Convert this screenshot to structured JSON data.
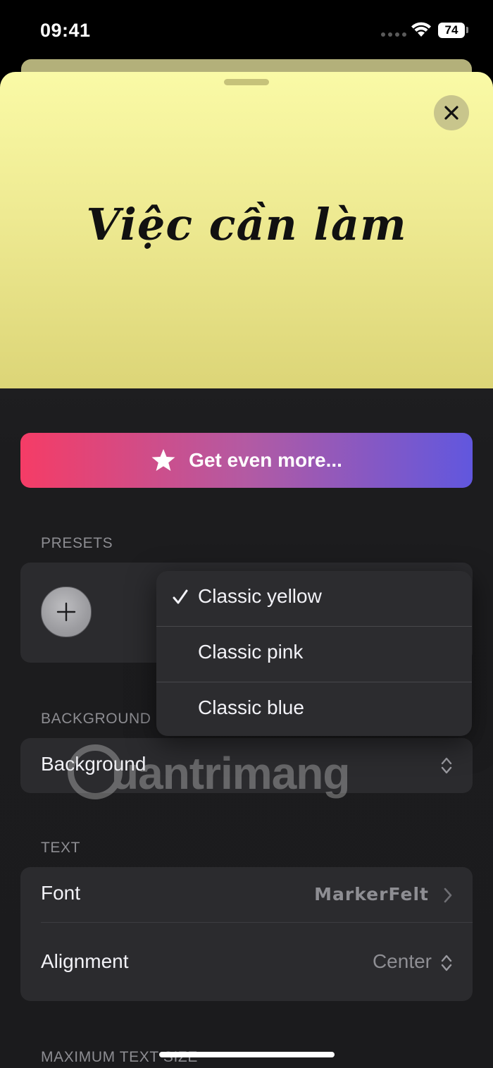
{
  "status_bar": {
    "time": "09:41",
    "battery": "74"
  },
  "preview": {
    "title": "Việc cần làm",
    "background_color": "#eeea92"
  },
  "promo": {
    "label": "Get even more..."
  },
  "presets": {
    "section_label": "PRESETS",
    "menu": [
      {
        "label": "Classic yellow",
        "selected": true
      },
      {
        "label": "Classic pink",
        "selected": false
      },
      {
        "label": "Classic blue",
        "selected": false
      }
    ]
  },
  "background": {
    "section_label": "BACKGROUND",
    "row_label": "Background"
  },
  "text": {
    "section_label": "TEXT",
    "font_label": "Font",
    "font_value": "MarkerFelt",
    "alignment_label": "Alignment",
    "alignment_value": "Center"
  },
  "max_text_size": {
    "section_label": "MAXIMUM TEXT SIZE"
  },
  "watermark": "uantrimang",
  "colors": {
    "accent_gradient_start": "#f53c66",
    "accent_gradient_end": "#6157de",
    "sheet_background": "#1c1c1e"
  }
}
